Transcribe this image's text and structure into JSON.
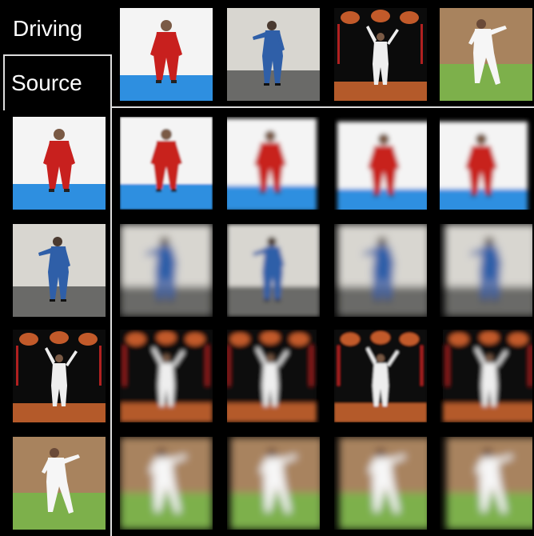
{
  "labels": {
    "driving": "Driving",
    "source": "Source"
  },
  "colors": {
    "red_suit": "#c8201e",
    "blue_suit": "#2f5fa8",
    "white_suit": "#eeeeee",
    "blue_floor": "#2e8fe0",
    "red_floor": "#b45a2a",
    "grass": "#7db04b",
    "brick": "#a8835e"
  },
  "grid": {
    "driving_row": [
      "red-studio",
      "blue-studio",
      "white-stage",
      "white-grass"
    ],
    "source_col": [
      "red-studio",
      "blue-studio",
      "white-stage",
      "white-grass"
    ]
  }
}
